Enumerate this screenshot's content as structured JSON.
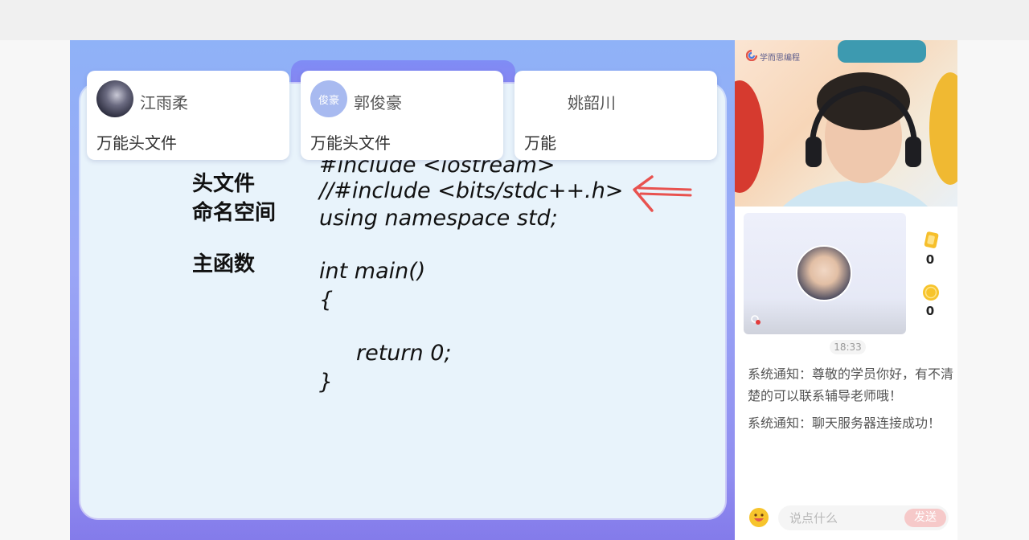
{
  "students": [
    {
      "name": "江雨柔",
      "answer": "万能头文件",
      "avatar_text": ""
    },
    {
      "name": "郭俊豪",
      "answer": "万能头文件",
      "avatar_text": "俊豪"
    },
    {
      "name": "姚韶川",
      "answer": "万能",
      "avatar_text": ""
    }
  ],
  "slide": {
    "labels": [
      "头文件",
      "命名空间",
      "主函数"
    ],
    "code_lines": [
      "#include <iostream>",
      "//#include <bits/stdc++.h>",
      "using namespace std;",
      "int main()",
      "{",
      "return 0;",
      "}"
    ]
  },
  "teacher_video": {
    "logo_text": "学而思编程"
  },
  "stats": {
    "cards": "0",
    "coins": "0"
  },
  "chat": {
    "timestamp": "18:33",
    "messages": [
      "系统通知：尊敬的学员你好，有不清楚的可以联系辅导老师哦！",
      "系统通知：聊天服务器连接成功！"
    ],
    "input_placeholder": "说点什么",
    "send_label": "发送"
  },
  "colors": {
    "accent": "#8d86ee",
    "annotation": "#e8524f",
    "send": "#f6c9c9"
  }
}
